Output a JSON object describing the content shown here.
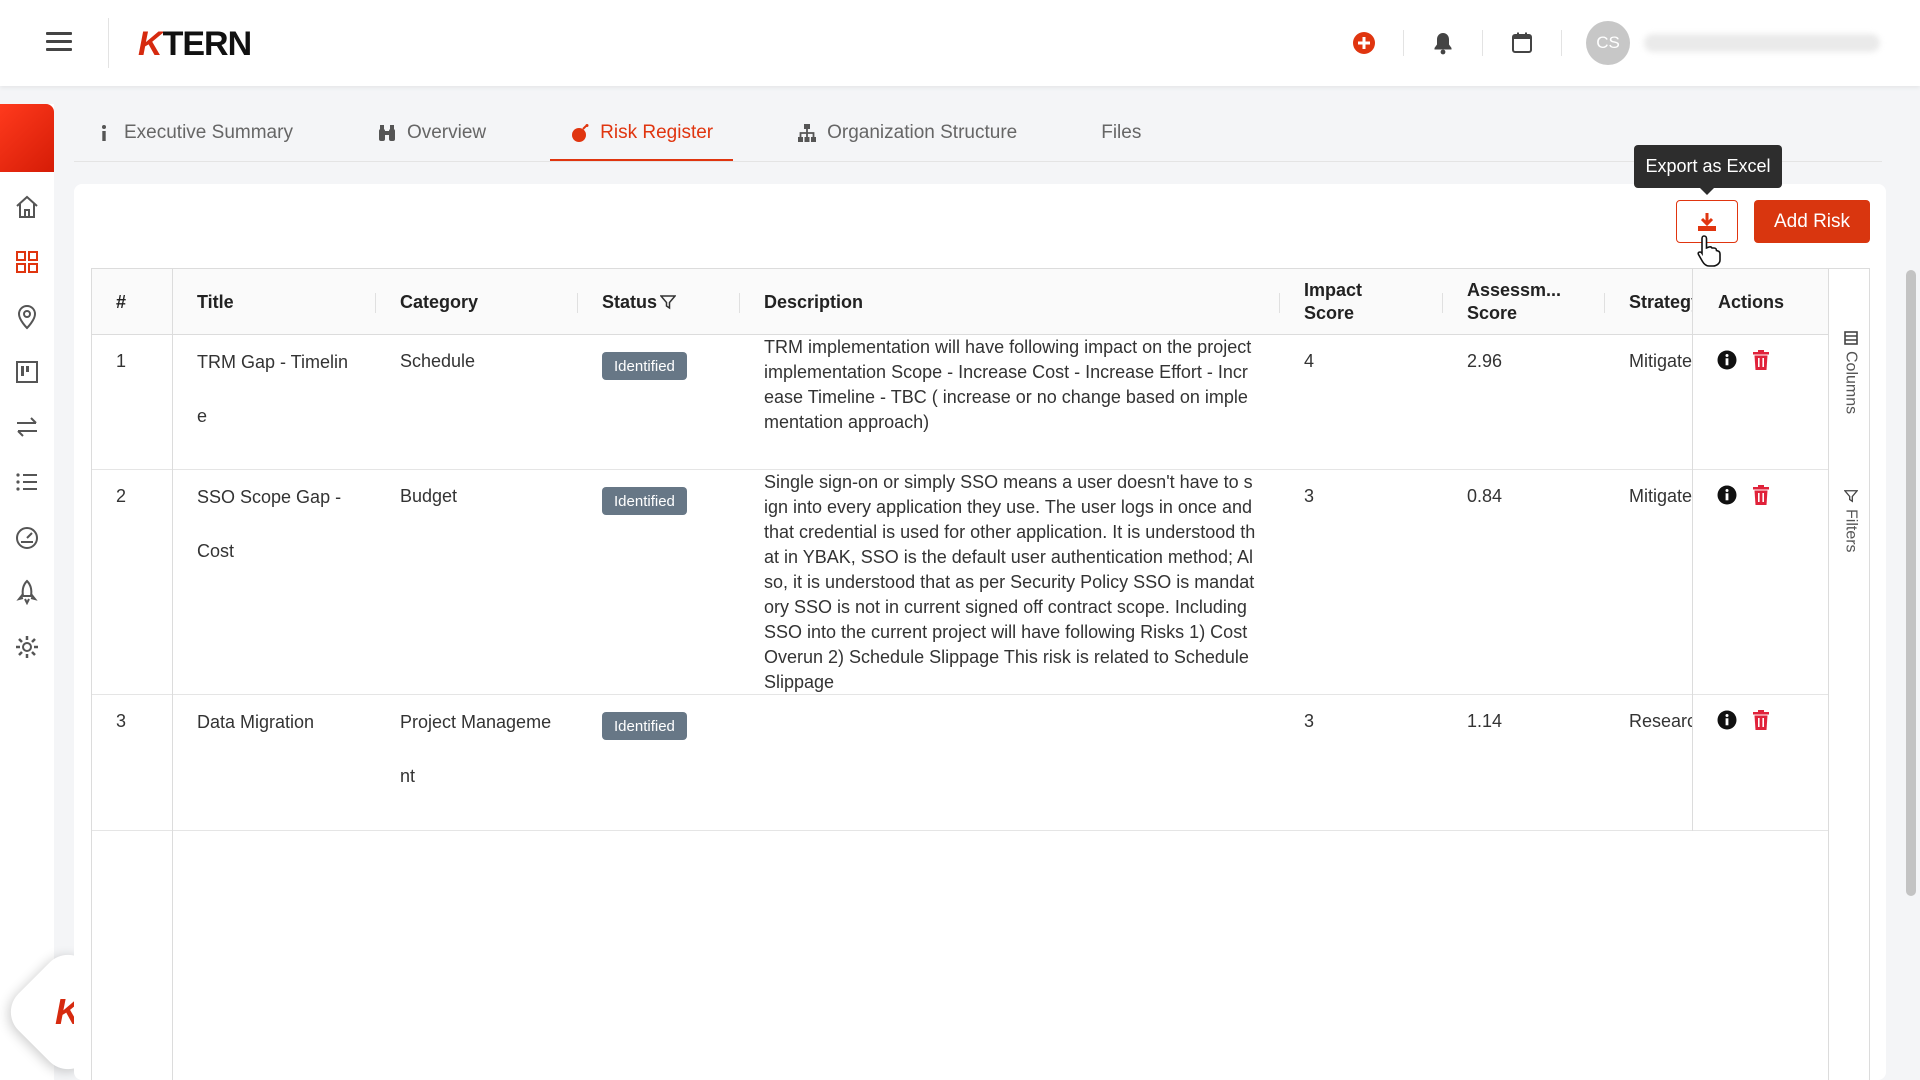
{
  "app": {
    "logo_k": "K",
    "logo_text": "TERN",
    "user_initials": "CS"
  },
  "tabs": [
    {
      "label": "Executive Summary"
    },
    {
      "label": "Overview"
    },
    {
      "label": "Risk Register"
    },
    {
      "label": "Organization Structure"
    },
    {
      "label": "Files"
    }
  ],
  "toolbar": {
    "tooltip": "Export as Excel",
    "add_label": "Add Risk"
  },
  "columns": {
    "num": "#",
    "title": "Title",
    "category": "Category",
    "status": "Status",
    "description": "Description",
    "impact_l1": "Impact",
    "impact_l2": "Score",
    "assess_l1": "Assessm...",
    "assess_l2": "Score",
    "strategy": "Strategy",
    "actions": "Actions"
  },
  "rows": [
    {
      "num": "1",
      "title": "TRM Gap - Timeline",
      "category": "Schedule",
      "status": "Identified",
      "description": "TRM implementation will have following impact on the project implementation Scope - Increase Cost - Increase Effort - Increase Timeline - TBC ( increase or no change based on implementation approach)",
      "impact": "4",
      "assessment": "2.96",
      "strategy": "Mitigate"
    },
    {
      "num": "2",
      "title": "SSO Scope Gap - Cost",
      "category": "Budget",
      "status": "Identified",
      "description": "Single sign-on or simply SSO means a user doesn't have to sign into every application they use. The user logs in once and that credential is used for other application. It is understood that in YBAK, SSO is the default user authentication method; Also, it is understood that as per Security Policy SSO is mandatory SSO is not in current signed off contract scope. Including SSO into the current project will have following Risks 1) Cost Overun 2) Schedule Slippage This risk is related to Schedule Slippage",
      "impact": "3",
      "assessment": "0.84",
      "strategy": "Mitigate"
    },
    {
      "num": "3",
      "title": "Data Migration",
      "category": "Project Management",
      "status": "Identified",
      "description": "",
      "impact": "3",
      "assessment": "1.14",
      "strategy": "Research"
    }
  ],
  "side": {
    "columns_label": "Columns",
    "filters_label": "Filters"
  },
  "colors": {
    "accent": "#d9360f",
    "badge": "#677786",
    "delete": "#e0223a"
  }
}
